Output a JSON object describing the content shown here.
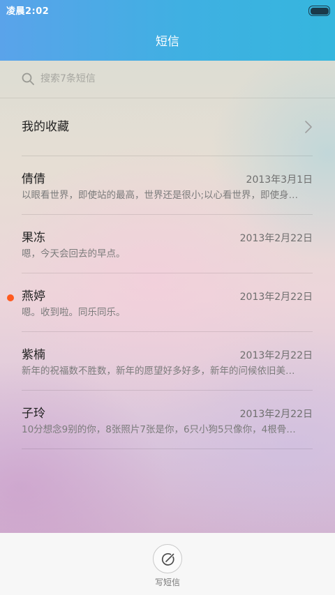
{
  "status_bar": {
    "time": "凌晨2:02",
    "battery_icon": "battery-full-icon"
  },
  "header": {
    "title": "短信"
  },
  "search": {
    "icon": "search-icon",
    "placeholder": "搜索7条短信"
  },
  "favorites": {
    "label": "我的收藏",
    "icon": "chevron-right-icon"
  },
  "conversations": [
    {
      "name": "倩倩",
      "date": "2013年3月1日",
      "preview": "以眼看世界，即使站的最高，世界还是很小;以心看世界，即使身…",
      "unread": false
    },
    {
      "name": "果冻",
      "date": "2013年2月22日",
      "preview": "嗯，今天会回去的早点。",
      "unread": false
    },
    {
      "name": "燕婷",
      "date": "2013年2月22日",
      "preview": "嗯。收到啦。同乐同乐。",
      "unread": true
    },
    {
      "name": "紫楠",
      "date": "2013年2月22日",
      "preview": "新年的祝福数不胜数，新年的愿望好多好多，新年的问候依旧美…",
      "unread": false
    },
    {
      "name": "子玲",
      "date": "2013年2月22日",
      "preview": "10分想念9别的你，8张照片7张是你，6只小狗5只像你，4根骨…",
      "unread": false
    }
  ],
  "compose": {
    "label": "写短信",
    "icon": "compose-icon"
  },
  "colors": {
    "header_start": "#5aa3ea",
    "header_end": "#35b6de",
    "unread_dot": "#ff5a1f"
  }
}
